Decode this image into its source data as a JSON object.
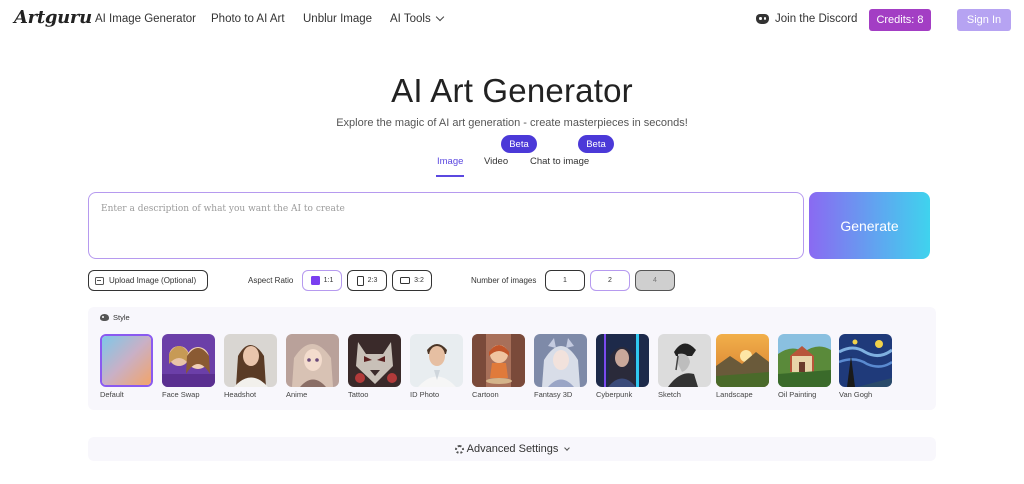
{
  "header": {
    "logo": "Artguru",
    "nav": {
      "ai_image_generator": "AI Image Generator",
      "photo_to_ai_art": "Photo to AI Art",
      "unblur_image": "Unblur Image",
      "ai_tools": "AI Tools"
    },
    "discord_label": "Join the Discord",
    "credits_label": "Credits: 8",
    "signin_label": "Sign In"
  },
  "hero": {
    "title": "AI Art Generator",
    "subtitle": "Explore the magic of AI art generation - create masterpieces in seconds!"
  },
  "tabs": [
    {
      "label": "Image",
      "active": true
    },
    {
      "label": "Video",
      "badge": "Beta"
    },
    {
      "label": "Chat to image",
      "badge": "Beta"
    }
  ],
  "prompt": {
    "placeholder": "Enter a description of what you want the AI to create",
    "value": ""
  },
  "generate_label": "Generate",
  "options": {
    "upload_label": "Upload Image (Optional)",
    "aspect_ratio_label": "Aspect Ratio",
    "aspect_ratios": [
      "1:1",
      "2:3",
      "3:2"
    ],
    "aspect_ratio_selected": "1:1",
    "number_of_images_label": "Number of images",
    "number_options": [
      "1",
      "2",
      "4"
    ],
    "number_selected": "2"
  },
  "style": {
    "header": "Style",
    "selected": "Default",
    "items": [
      {
        "label": "Default"
      },
      {
        "label": "Face Swap"
      },
      {
        "label": "Headshot"
      },
      {
        "label": "Anime"
      },
      {
        "label": "Tattoo"
      },
      {
        "label": "ID Photo"
      },
      {
        "label": "Cartoon"
      },
      {
        "label": "Fantasy 3D"
      },
      {
        "label": "Cyberpunk"
      },
      {
        "label": "Sketch"
      },
      {
        "label": "Landscape"
      },
      {
        "label": "Oil Painting"
      },
      {
        "label": "Van Gogh"
      }
    ]
  },
  "advanced_label": "Advanced Settings",
  "colors": {
    "accent": "#5b48e0",
    "credits_bg": "#a33ec4",
    "signin_bg": "#b6a3f2",
    "beta_bg": "#4b39d8",
    "generate_gradient_start": "#8a6af2",
    "generate_gradient_end": "#3fd3ee"
  }
}
